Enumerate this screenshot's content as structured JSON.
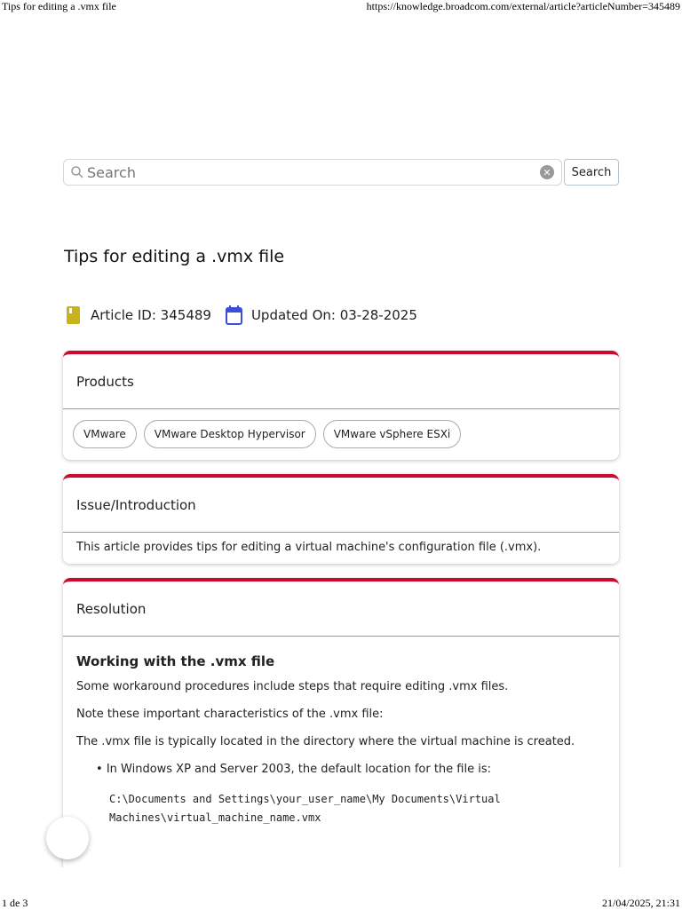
{
  "print_header": {
    "title": "Tips for editing a .vmx file",
    "url": "https://knowledge.broadcom.com/external/article?articleNumber=345489"
  },
  "print_footer": {
    "page": "1 de 3",
    "datetime": "21/04/2025, 21:31"
  },
  "search": {
    "placeholder": "Search",
    "button": "Search"
  },
  "article": {
    "title": "Tips for editing a .vmx file",
    "article_id": "Article ID: 345489",
    "updated": "Updated On: 03-28-2025"
  },
  "products": {
    "heading": "Products",
    "items": [
      "VMware",
      "VMware Desktop Hypervisor",
      "VMware vSphere ESXi"
    ]
  },
  "issue": {
    "heading": "Issue/Introduction",
    "text": "This article provides tips for editing a virtual machine's configuration file (.vmx)."
  },
  "resolution": {
    "heading": "Resolution",
    "subheading": "Working with the .vmx file",
    "p1": "Some workaround procedures include steps that require editing .vmx files.",
    "p2": "Note these important characteristics of the .vmx file:",
    "p3": "The .vmx file is typically located in the directory where the virtual machine is created.",
    "bullet1": "In Windows XP and Server 2003, the default location for the file is:",
    "code_line1": "C:\\Documents and Settings\\your_user_name\\My Documents\\Virtual",
    "code_line2": "Machines\\virtual_machine_name.vmx"
  },
  "colors": {
    "accent": "#cc092f",
    "id_icon": "#c9b21a",
    "calendar_icon": "#3b4fd8"
  }
}
